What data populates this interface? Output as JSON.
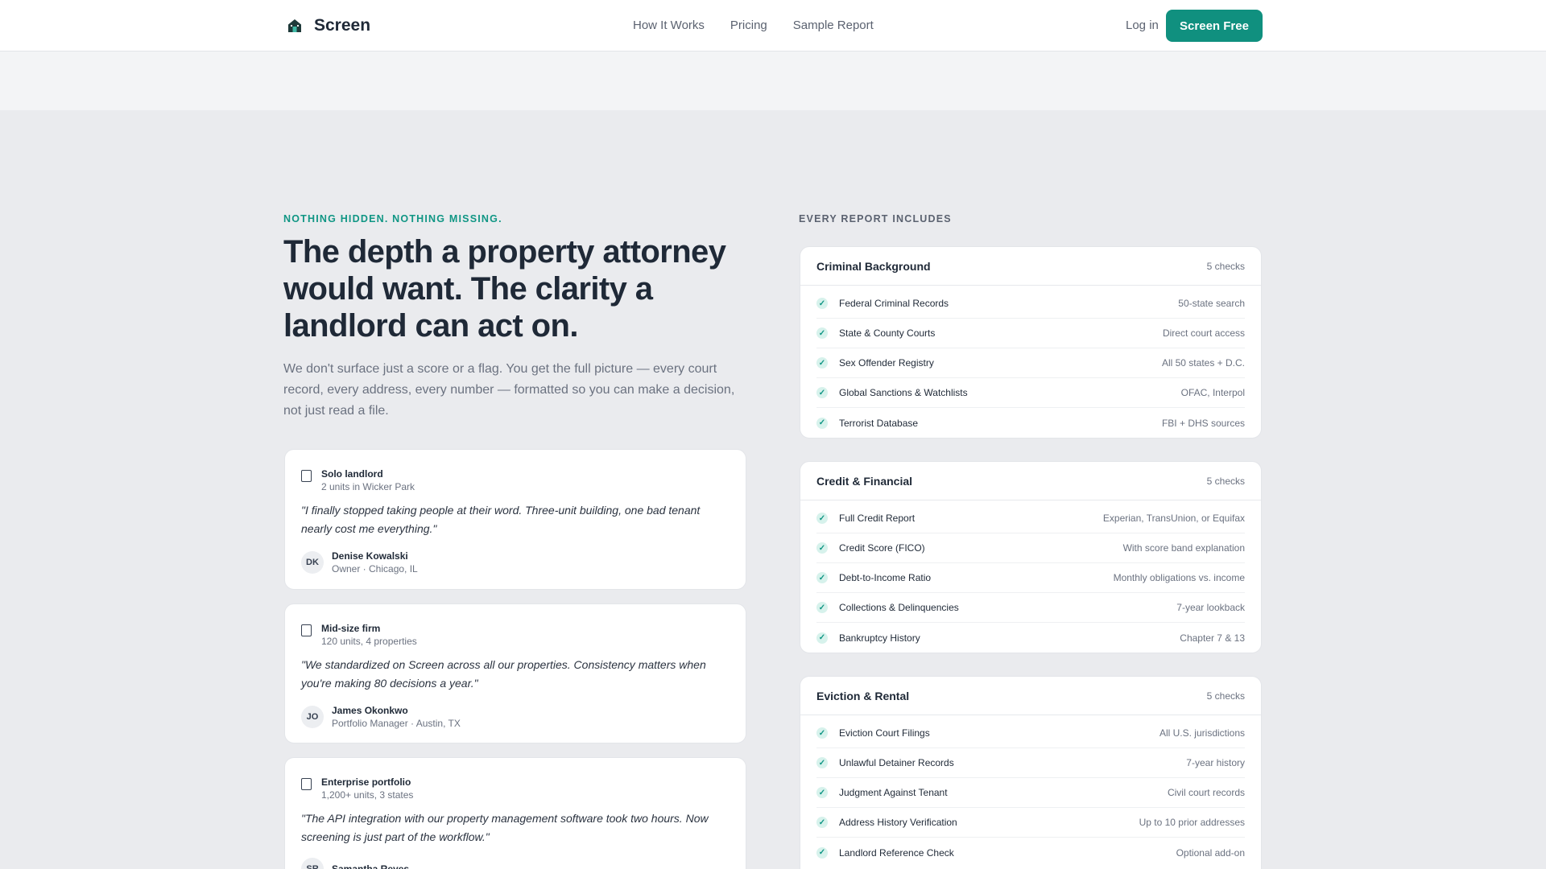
{
  "header": {
    "brand": "Screen",
    "nav": [
      "How It Works",
      "Pricing",
      "Sample Report"
    ],
    "login": "Log in",
    "cta": "Screen Free"
  },
  "left": {
    "eyebrow": "NOTHING HIDDEN. NOTHING MISSING.",
    "headline": "The depth a property attorney would want. The clarity a landlord can act on.",
    "intro": "We don't surface just a score or a flag. You get the full picture — every court record, every address, every number — formatted so you can make a decision, not just read a file.",
    "testimonials": [
      {
        "segment": "Solo landlord",
        "detail": "2 units in Wicker Park",
        "quote": "\"I finally stopped taking people at their word. Three-unit building, one bad tenant nearly cost me everything.\"",
        "initials": "DK",
        "name": "Denise Kowalski",
        "role": "Owner · Chicago, IL"
      },
      {
        "segment": "Mid-size firm",
        "detail": "120 units, 4 properties",
        "quote": "\"We standardized on Screen across all our properties. Consistency matters when you're making 80 decisions a year.\"",
        "initials": "JO",
        "name": "James Okonkwo",
        "role": "Portfolio Manager · Austin, TX"
      },
      {
        "segment": "Enterprise portfolio",
        "detail": "1,200+ units, 3 states",
        "quote": "\"The API integration with our property management software took two hours. Now screening is just part of the workflow.\"",
        "initials": "SR",
        "name": "Samantha Reyes",
        "role": ""
      }
    ]
  },
  "right": {
    "eyebrow": "EVERY REPORT INCLUDES",
    "groups": [
      {
        "title": "Criminal Background",
        "count": "5 checks",
        "items": [
          {
            "label": "Federal Criminal Records",
            "note": "50-state search"
          },
          {
            "label": "State & County Courts",
            "note": "Direct court access"
          },
          {
            "label": "Sex Offender Registry",
            "note": "All 50 states + D.C."
          },
          {
            "label": "Global Sanctions & Watchlists",
            "note": "OFAC, Interpol"
          },
          {
            "label": "Terrorist Database",
            "note": "FBI + DHS sources"
          }
        ]
      },
      {
        "title": "Credit & Financial",
        "count": "5 checks",
        "items": [
          {
            "label": "Full Credit Report",
            "note": "Experian, TransUnion, or Equifax"
          },
          {
            "label": "Credit Score (FICO)",
            "note": "With score band explanation"
          },
          {
            "label": "Debt-to-Income Ratio",
            "note": "Monthly obligations vs. income"
          },
          {
            "label": "Collections & Delinquencies",
            "note": "7-year lookback"
          },
          {
            "label": "Bankruptcy History",
            "note": "Chapter 7 & 13"
          }
        ]
      },
      {
        "title": "Eviction & Rental",
        "count": "5 checks",
        "items": [
          {
            "label": "Eviction Court Filings",
            "note": "All U.S. jurisdictions"
          },
          {
            "label": "Unlawful Detainer Records",
            "note": "7-year history"
          },
          {
            "label": "Judgment Against Tenant",
            "note": "Civil court records"
          },
          {
            "label": "Address History Verification",
            "note": "Up to 10 prior addresses"
          },
          {
            "label": "Landlord Reference Check",
            "note": "Optional add-on"
          }
        ]
      }
    ]
  }
}
